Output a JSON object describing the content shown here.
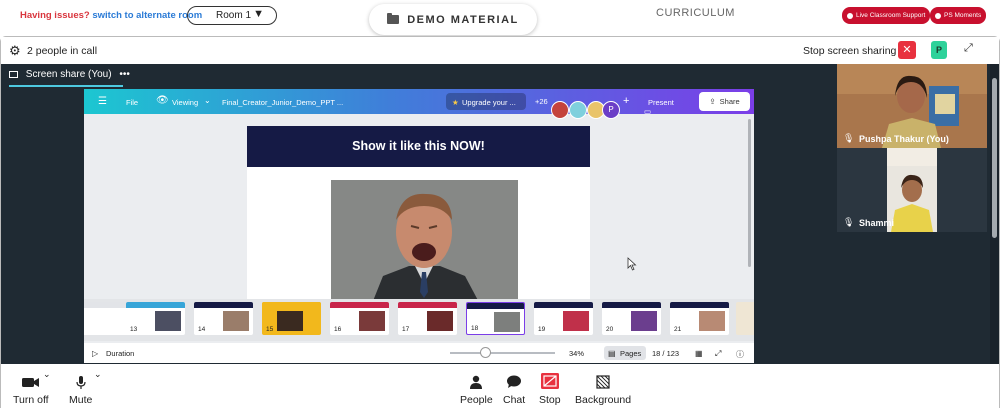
{
  "topbar": {
    "issue_prefix": "Having issues?",
    "issue_link": "switch to alternate room",
    "room_selected": "Room 1",
    "demo_material": "DEMO MATERIAL",
    "curriculum": "CURRICULUM",
    "live_support": "Live Classroom Support",
    "ps_moments": "PS Moments"
  },
  "call": {
    "people_count": "2 people in call",
    "stop_sharing": "Stop screen sharing",
    "participant_initial": "P",
    "share_tab": "Screen share (You)",
    "more": "•••"
  },
  "canva": {
    "menu": "File",
    "viewing": "Viewing",
    "filename": "Final_Creator_Junior_Demo_PPT ...",
    "upgrade": "Upgrade your ...",
    "collab_count": "+26",
    "avatar_letter": "P",
    "present": "Present",
    "share": "Share",
    "slide_title": "Show it like this NOW!",
    "duration": "Duration",
    "zoom": "34%",
    "pages_label": "Pages",
    "page_indicator": "18 / 123",
    "thumbnails": [
      {
        "num": "",
        "band": "#e2e4e8"
      },
      {
        "num": "13",
        "band": "#37a5d8"
      },
      {
        "num": "14",
        "band": "#151a45"
      },
      {
        "num": "15",
        "band": "#f2b81c"
      },
      {
        "num": "16",
        "band": "#c8254a"
      },
      {
        "num": "17",
        "band": "#c8254a"
      },
      {
        "num": "18",
        "band": "#151a45"
      },
      {
        "num": "19",
        "band": "#151a45"
      },
      {
        "num": "20",
        "band": "#151a45"
      },
      {
        "num": "21",
        "band": "#151a45"
      }
    ]
  },
  "participants": [
    {
      "name": "Pushpa Thakur (You)"
    },
    {
      "name": "Shammi"
    }
  ],
  "toolbar": {
    "turn_off": "Turn off",
    "mute": "Mute",
    "people": "People",
    "chat": "Chat",
    "stop": "Stop",
    "background": "Background"
  },
  "colors": {
    "accent_red": "#c8102e",
    "stage_bg": "#1f2a33",
    "slide_header": "#151a45",
    "share_underline": "#4ec9e0"
  }
}
